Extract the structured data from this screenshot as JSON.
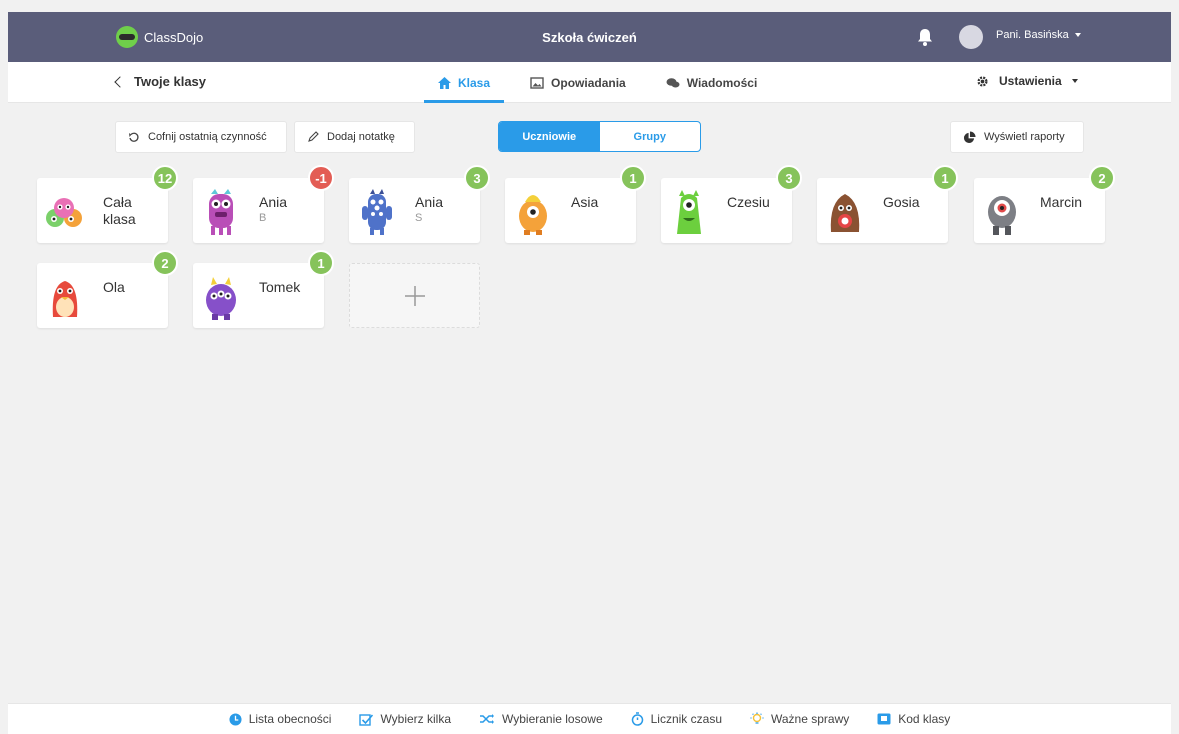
{
  "header": {
    "brand": "ClassDojo",
    "school": "Szkoła ćwiczeń",
    "user": "Pani. Basińska"
  },
  "subnav": {
    "back_label": "Twoje klasy",
    "tabs": [
      {
        "label": "Klasa",
        "icon": "home-icon",
        "active": true
      },
      {
        "label": "Opowiadania",
        "icon": "image-icon",
        "active": false
      },
      {
        "label": "Wiadomości",
        "icon": "chat-icon",
        "active": false
      }
    ],
    "settings": "Ustawienia"
  },
  "toolbar": {
    "undo_label": "Cofnij ostatnią czynność",
    "note_label": "Dodaj notatkę",
    "segment_students": "Uczniowie",
    "segment_groups": "Grupy",
    "reports_label": "Wyświetl raporty"
  },
  "students": [
    {
      "name": "Cała klasa",
      "sub": "",
      "points": "12"
    },
    {
      "name": "Ania",
      "sub": "B",
      "points": "-1"
    },
    {
      "name": "Ania",
      "sub": "S",
      "points": "3"
    },
    {
      "name": "Asia",
      "sub": "",
      "points": "1"
    },
    {
      "name": "Czesiu",
      "sub": "",
      "points": "3"
    },
    {
      "name": "Gosia",
      "sub": "",
      "points": "1"
    },
    {
      "name": "Marcin",
      "sub": "",
      "points": "2"
    },
    {
      "name": "Ola",
      "sub": "",
      "points": "2"
    },
    {
      "name": "Tomek",
      "sub": "",
      "points": "1"
    }
  ],
  "bottom": [
    {
      "label": "Lista obecności",
      "icon": "clock-icon"
    },
    {
      "label": "Wybierz kilka",
      "icon": "checkbox-icon"
    },
    {
      "label": "Wybieranie losowe",
      "icon": "shuffle-icon"
    },
    {
      "label": "Licznik czasu",
      "icon": "timer-icon"
    },
    {
      "label": "Ważne sprawy",
      "icon": "lightbulb-icon"
    },
    {
      "label": "Kod klasy",
      "icon": "code-icon"
    }
  ],
  "colors": {
    "header": "#5a5d7a",
    "accent": "#2a9be8",
    "positive_badge": "#86c35b",
    "negative_badge": "#e35d55"
  }
}
